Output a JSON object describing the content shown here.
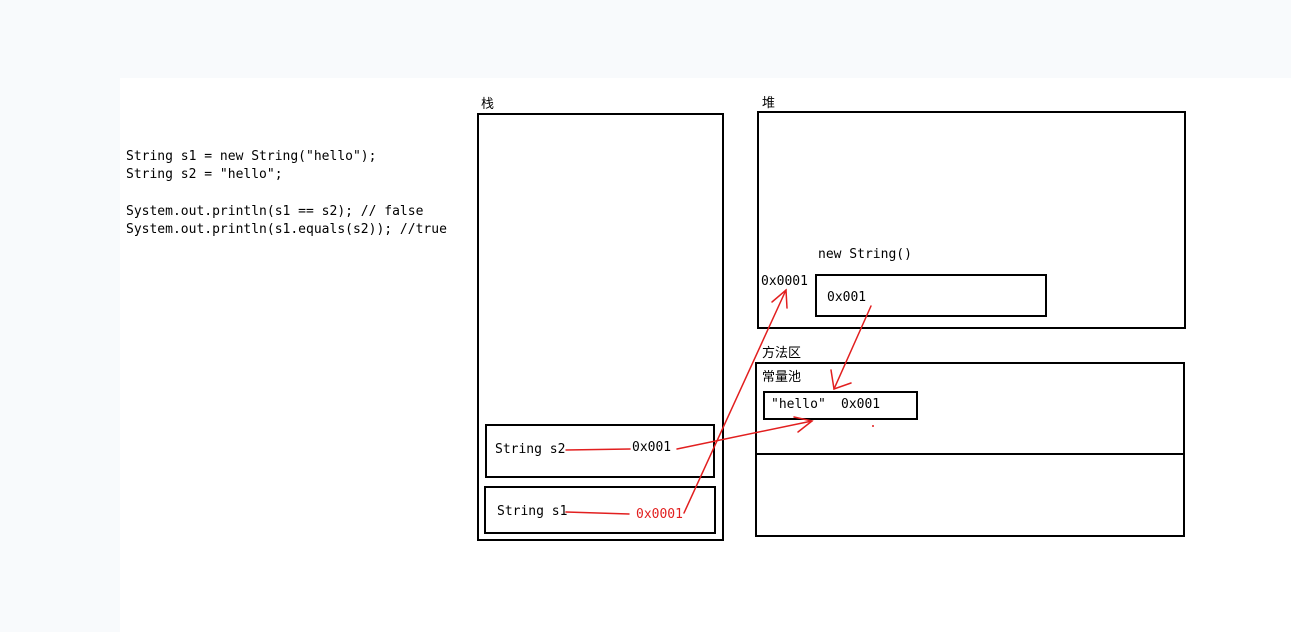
{
  "code": {
    "line1": "String s1 = new String(\"hello\");",
    "line2": "String s2 = \"hello\";",
    "line3": "System.out.println(s1 == s2); // false",
    "line4": "System.out.println(s1.equals(s2)); //true"
  },
  "stack": {
    "title": "栈",
    "s2_label": "String s2",
    "s2_value": "0x001",
    "s1_label": "String s1",
    "s1_value": "0x0001"
  },
  "heap": {
    "title": "堆",
    "object_label": "new String()",
    "object_address": "0x0001",
    "object_value": "0x001"
  },
  "method_area": {
    "title": "方法区",
    "constant_pool_title": "常量池",
    "pool_literal": "\"hello\"",
    "pool_address": "0x001"
  },
  "colors": {
    "arrow": "#e21f1f",
    "border": "#000000"
  }
}
